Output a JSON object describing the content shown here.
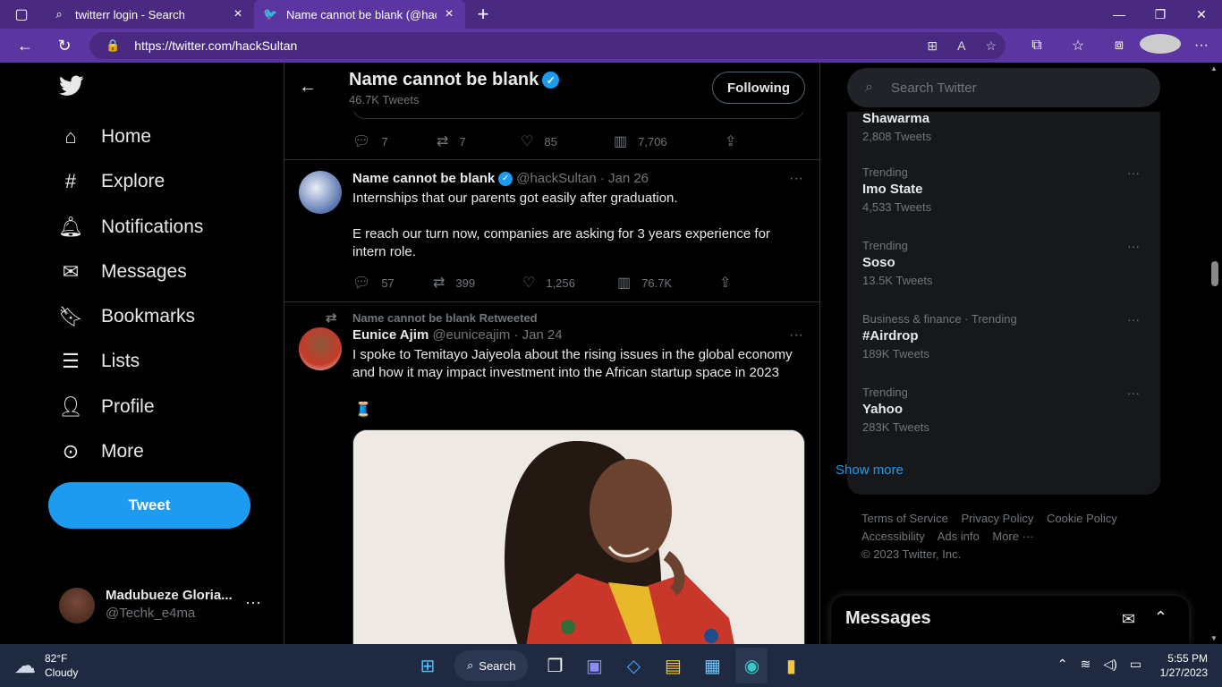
{
  "browser": {
    "tabs": [
      {
        "title": "twitterr login - Search",
        "active": false
      },
      {
        "title": "Name cannot be blank (@hackSu",
        "active": true
      }
    ],
    "url": "https://twitter.com/hackSultan"
  },
  "nav": {
    "items": [
      "Home",
      "Explore",
      "Notifications",
      "Messages",
      "Bookmarks",
      "Lists",
      "Profile",
      "More"
    ],
    "tweet_button": "Tweet",
    "account": {
      "name": "Madubueze Gloria...",
      "handle": "@Techk_e4ma"
    }
  },
  "header": {
    "title": "Name cannot be blank",
    "subtitle": "46.7K Tweets",
    "follow_label": "Following"
  },
  "tweets": [
    {
      "stats": {
        "replies": "7",
        "retweets": "7",
        "likes": "85",
        "views": "7,706"
      }
    },
    {
      "name": "Name cannot be blank",
      "meta": "@hackSultan · Jan 26",
      "text1": "Internships that our parents got easily after graduation.",
      "text2": "E reach our turn now, companies are asking for 3 years experience for intern role.",
      "stats": {
        "replies": "57",
        "retweets": "399",
        "likes": "1,256",
        "views": "76.7K"
      }
    },
    {
      "retweeted_by": "Name cannot be blank Retweeted",
      "name": "Eunice Ajim",
      "meta": "@euniceajim · Jan 24",
      "text": "I spoke to Temitayo Jaiyeola about the rising issues in the global economy and how it may impact investment into the African startup space in 2023"
    }
  ],
  "sidebar": {
    "search_placeholder": "Search Twitter",
    "trends": [
      {
        "category": "",
        "name": "Shawarma",
        "count": "2,808 Tweets"
      },
      {
        "category": "Trending",
        "name": "Imo State",
        "count": "4,533 Tweets"
      },
      {
        "category": "Trending",
        "name": "Soso",
        "count": "13.5K Tweets"
      },
      {
        "category": "Business & finance · Trending",
        "name": "#Airdrop",
        "count": "189K Tweets"
      },
      {
        "category": "Trending",
        "name": "Yahoo",
        "count": "283K Tweets"
      }
    ],
    "show_more": "Show more",
    "footer": {
      "terms": "Terms of Service",
      "privacy": "Privacy Policy",
      "cookie": "Cookie Policy",
      "accessibility": "Accessibility",
      "ads": "Ads info",
      "more": "More ···",
      "copyright": "© 2023 Twitter, Inc."
    },
    "messages_title": "Messages"
  },
  "taskbar": {
    "temp": "82°F",
    "weather": "Cloudy",
    "search_label": "Search",
    "time": "5:55 PM",
    "date": "1/27/2023"
  },
  "colors": {
    "accent": "#1d9bf0",
    "browser_frame": "#5b35a0"
  }
}
